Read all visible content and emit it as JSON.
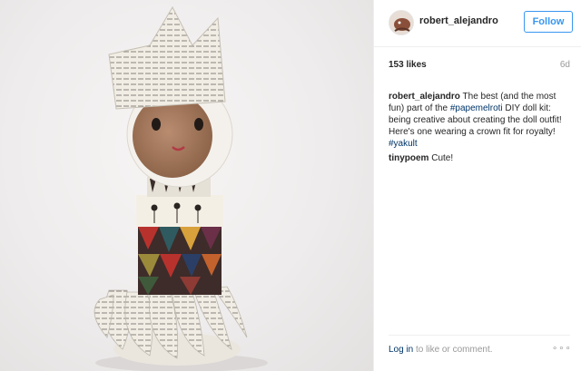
{
  "post": {
    "username": "robert_alejandro",
    "follow_label": "Follow",
    "likes": "153 likes",
    "time_ago": "6d"
  },
  "comments": [
    {
      "user": "robert_alejandro",
      "text_before": "The best (and the most fun) part of the ",
      "tag1": "#papemelroti",
      "text_middle": " DIY doll kit: being creative about creating the doll outfit! Here's one wearing a crown fit for royalty! ",
      "tag2": "#yakult"
    },
    {
      "user": "tinypoem",
      "text": "Cute!"
    }
  ],
  "footer": {
    "login_link": "Log in",
    "login_rest": " to like or comment.",
    "more": "∘∘∘"
  },
  "icons": {
    "more": "more-options-icon"
  },
  "colors": {
    "follow": "#3897f0",
    "hashtag": "#003569",
    "muted": "#999999"
  }
}
